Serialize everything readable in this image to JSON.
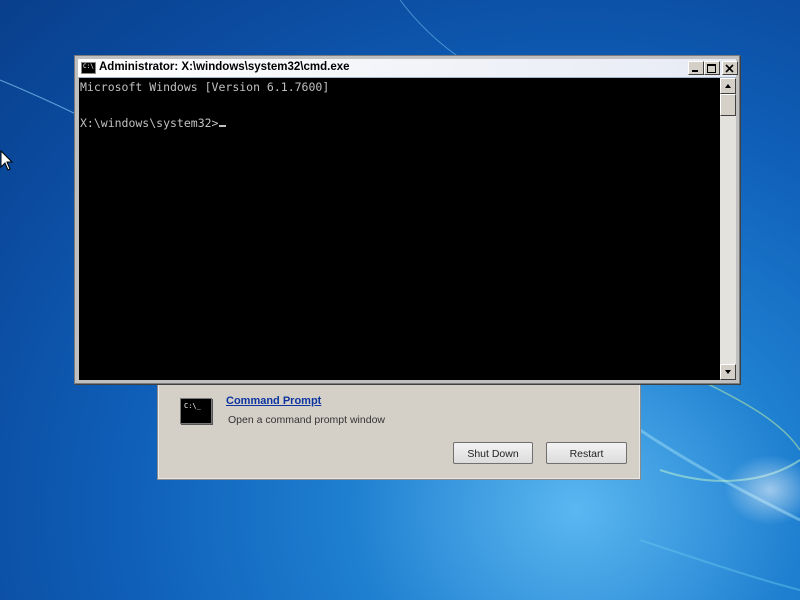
{
  "desktop": {
    "wallpaper": "windows-7-blue-wallpaper",
    "colors": {
      "deep_blue": "#0b4a9e",
      "light_blue": "#5bb7f0"
    }
  },
  "cmd_window": {
    "title": "Administrator: X:\\windows\\system32\\cmd.exe",
    "icon_text": "C:\\",
    "console_lines": [
      "Microsoft Windows [Version 6.1.7600]",
      "",
      "X:\\windows\\system32>"
    ],
    "controls": {
      "minimize": "minimize-icon",
      "maximize": "maximize-icon",
      "close": "close-icon"
    },
    "colors": {
      "console_bg": "#000000",
      "console_text": "#c0c0c0"
    }
  },
  "recovery_dialog": {
    "option": {
      "icon_text": "C:\\_",
      "title": "Command Prompt",
      "description": "Open a command prompt window"
    },
    "buttons": {
      "shutdown_label": "Shut Down",
      "restart_label": "Restart"
    },
    "colors": {
      "link": "#0c33a0",
      "background": "#d4d0c8"
    }
  }
}
